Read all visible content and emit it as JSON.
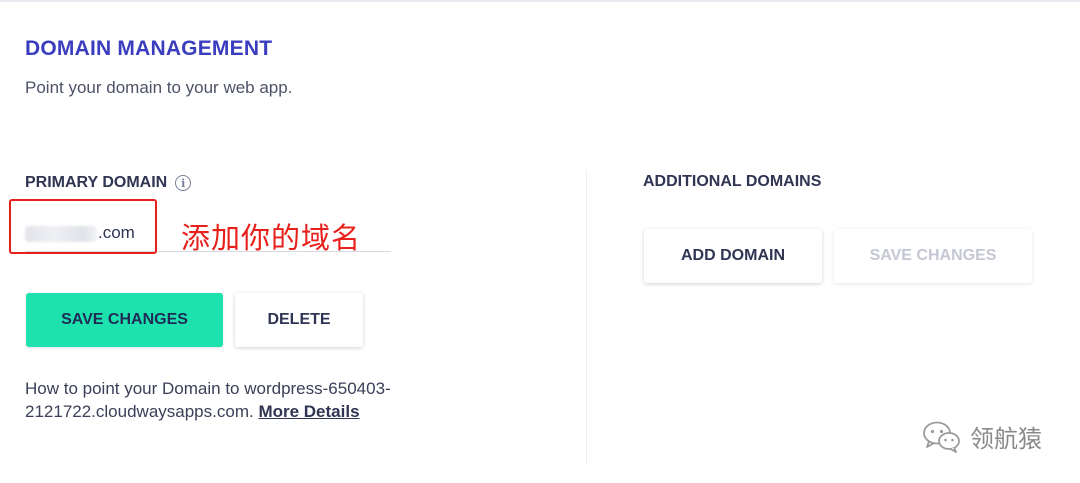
{
  "header": {
    "title": "DOMAIN MANAGEMENT",
    "subtitle": "Point your domain to your web app."
  },
  "primary": {
    "label": "PRIMARY DOMAIN",
    "info_icon": "info-icon",
    "domain_value_visible": ".com",
    "annotation": "添加你的域名",
    "save_label": "SAVE CHANGES",
    "delete_label": "DELETE",
    "help_text": "How to point your Domain to wordpress-650403-2121722.cloudwaysapps.com.",
    "help_link": "More Details"
  },
  "additional": {
    "label": "ADDITIONAL DOMAINS",
    "add_label": "ADD DOMAIN",
    "save_label": "SAVE CHANGES"
  },
  "watermark": {
    "text": "领航猿",
    "icon": "wechat-icon"
  },
  "colors": {
    "title": "#3b3dbf",
    "primary_button": "#1de2ad",
    "annotation_red": "#e8201b",
    "disabled_text": "#c4c7d3"
  }
}
